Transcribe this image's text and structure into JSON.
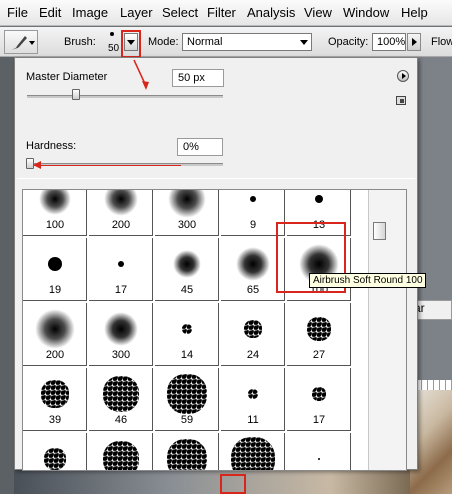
{
  "menu": [
    "File",
    "Edit",
    "Image",
    "Layer",
    "Select",
    "Filter",
    "Analysis",
    "View",
    "Window",
    "Help"
  ],
  "options_bar": {
    "brush_label": "Brush:",
    "brush_size": "50",
    "mode_label": "Mode:",
    "mode_value": "Normal",
    "opacity_label": "Opacity:",
    "opacity_value": "100%",
    "flow_label": "Flow"
  },
  "brush_popup": {
    "master_diameter_label": "Master Diameter",
    "master_diameter_value": "50 px",
    "master_diameter_level": 0.25,
    "hardness_label": "Hardness:",
    "hardness_value": "0%",
    "hardness_level": 0
  },
  "brush_presets": [
    [
      "100",
      "200",
      "300",
      "9",
      "13"
    ],
    [
      "19",
      "17",
      "45",
      "65",
      "100"
    ],
    [
      "200",
      "300",
      "14",
      "24",
      "27"
    ],
    [
      "39",
      "46",
      "59",
      "11",
      "17"
    ],
    [
      "",
      "",
      "",
      "",
      ""
    ]
  ],
  "tooltip": "Airbrush Soft Round 100",
  "canvas_ruler_text": "ar"
}
